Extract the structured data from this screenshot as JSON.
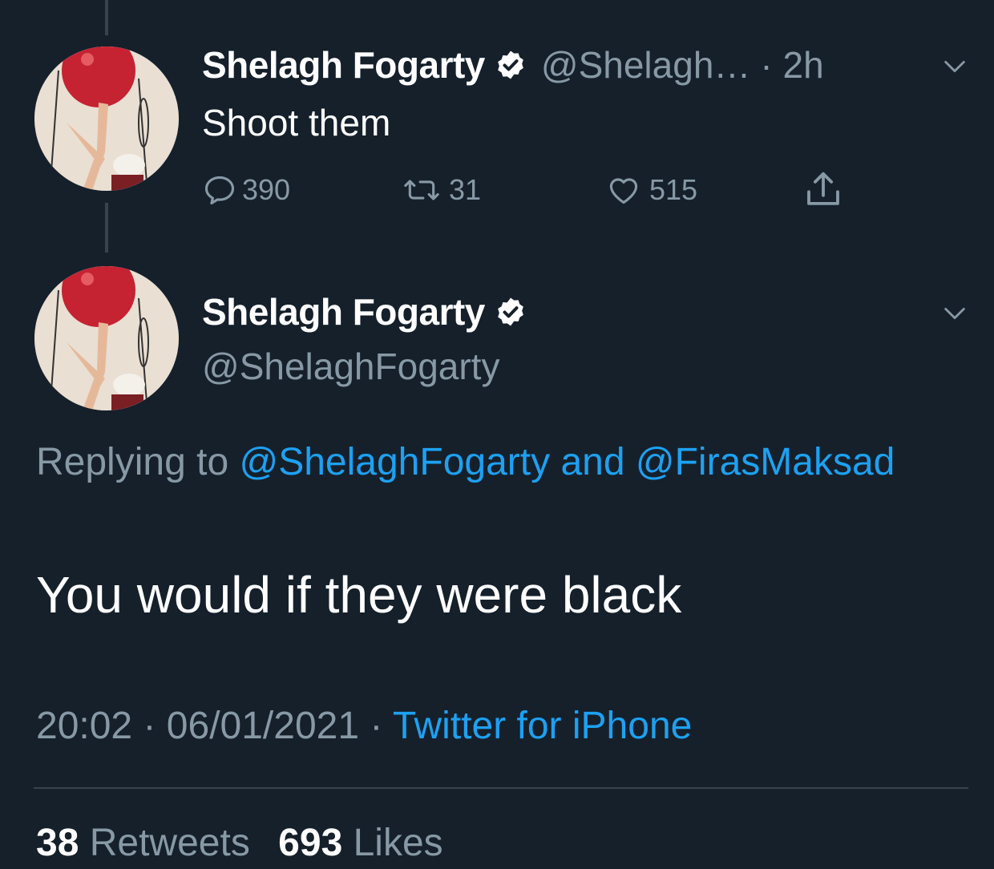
{
  "colors": {
    "background": "#15202b",
    "primary_text": "#ffffff",
    "secondary_text": "#8899a6",
    "link": "#1da1f2",
    "divider": "#38444d"
  },
  "tweet1": {
    "display_name": "Shelagh Fogarty",
    "handle": "@Shelagh…",
    "time": "· 2h",
    "text": "Shoot them",
    "replies": "390",
    "retweets": "31",
    "likes": "515",
    "icons": [
      "verified-badge-icon",
      "chevron-down-icon",
      "reply-icon",
      "retweet-icon",
      "like-icon",
      "share-icon"
    ]
  },
  "tweet2": {
    "display_name": "Shelagh Fogarty",
    "handle": "@ShelaghFogarty",
    "replying_prefix": "Replying to",
    "replying_user1": "@ShelaghFogarty",
    "replying_and": "and",
    "replying_user2": "@FirasMaksad",
    "text": "You would if they were black",
    "time": "20:02",
    "date": "06/01/2021",
    "source": "Twitter for iPhone",
    "retweet_count": "38",
    "retweet_label": "Retweets",
    "like_count": "693",
    "like_label": "Likes"
  }
}
